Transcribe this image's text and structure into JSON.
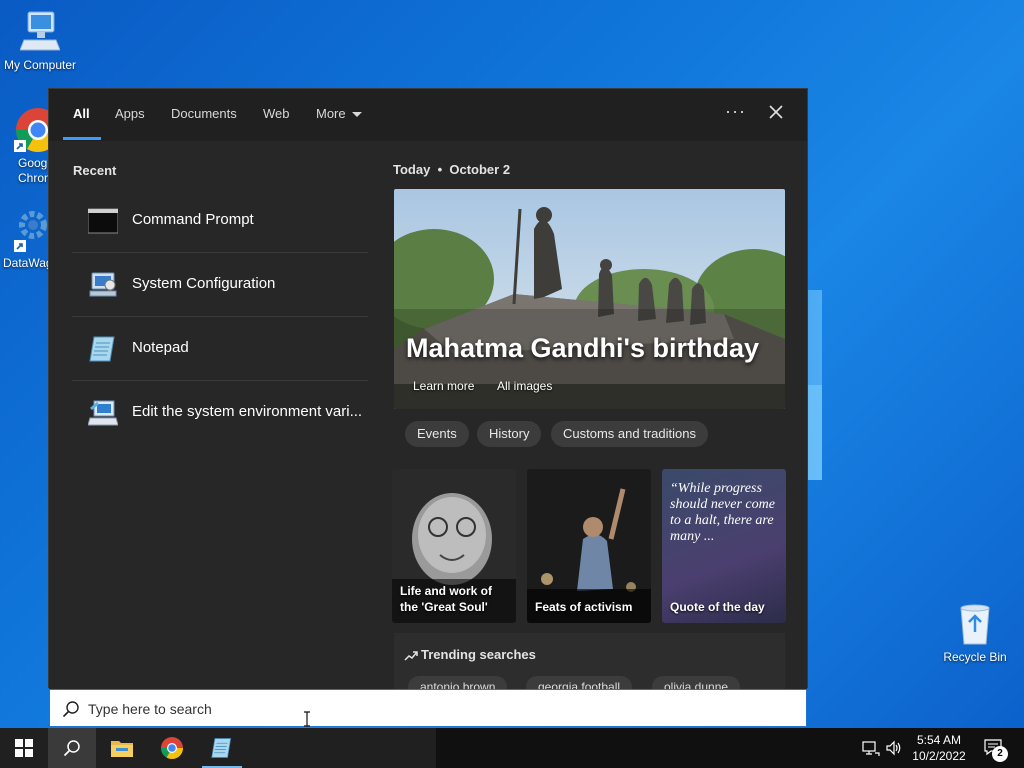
{
  "desktop": {
    "icons": [
      {
        "label": "My Computer"
      },
      {
        "label": "Goog\nChron"
      },
      {
        "label": "DataWag"
      },
      {
        "label": "Recycle Bin"
      }
    ]
  },
  "search_panel": {
    "tabs": [
      {
        "label": "All",
        "active": true
      },
      {
        "label": "Apps"
      },
      {
        "label": "Documents"
      },
      {
        "label": "Web"
      },
      {
        "label": "More"
      }
    ],
    "more_options": "···",
    "recent": {
      "title": "Recent",
      "items": [
        {
          "label": "Command Prompt",
          "icon": "command-prompt-icon"
        },
        {
          "label": "System Configuration",
          "icon": "system-configuration-icon"
        },
        {
          "label": "Notepad",
          "icon": "notepad-icon"
        },
        {
          "label": "Edit the system environment vari...",
          "icon": "system-properties-icon"
        }
      ]
    },
    "today": {
      "heading_day": "Today",
      "separator": "•",
      "heading_date": "October 2",
      "hero_title": "Mahatma Gandhi's birthday",
      "learn_more": "Learn more",
      "all_images": "All images",
      "pills": [
        "Events",
        "History",
        "Customs and traditions"
      ],
      "cards": [
        {
          "label": "Life and work of the 'Great Soul'"
        },
        {
          "label": "Feats of activism"
        },
        {
          "label": "Quote of the day",
          "quote": "“While progress should never come to a halt, there are many ..."
        }
      ]
    },
    "trending": {
      "title": "Trending searches",
      "items": [
        "antonio brown",
        "georgia football",
        "olivia dunne"
      ]
    }
  },
  "searchbar": {
    "placeholder": "Type here to search"
  },
  "taskbar": {
    "time": "5:54 AM",
    "date": "10/2/2022",
    "notification_count": "2"
  }
}
